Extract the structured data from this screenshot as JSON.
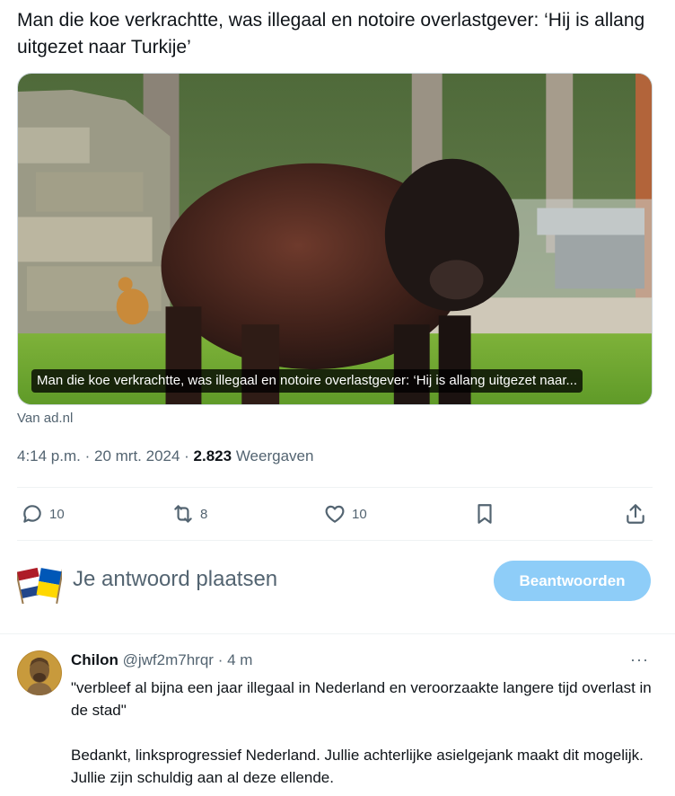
{
  "tweet": {
    "text": "Man die koe verkrachtte, was illegaal en notoire overlastgever: ‘Hij is allang uitgezet naar Turkije’"
  },
  "card": {
    "caption": "Man die koe verkrachtte, was illegaal en notoire overlastgever: ‘Hij is allang uitgezet naar...",
    "source": "Van ad.nl"
  },
  "meta": {
    "time": "4:14 p.m.",
    "sep1": " · ",
    "date": "20 mrt. 2024",
    "sep2": " · ",
    "views": "2.823",
    "views_label": " Weergaven"
  },
  "actions": {
    "replies": "10",
    "reposts": "8",
    "likes": "10"
  },
  "reply_box": {
    "placeholder": "Je antwoord plaatsen",
    "button": "Beantwoorden"
  },
  "reply": {
    "name": "Chilon",
    "handle": "@jwf2m7hrqr",
    "time": " · 4 m",
    "more": "···",
    "paragraph1": "\"verbleef al bijna een jaar illegaal in Nederland en veroorzaakte langere tijd overlast in de stad\"",
    "paragraph2": "Bedankt, linksprogressief Nederland. Jullie achterlijke asielgejank maakt dit mogelijk. Jullie zijn schuldig aan al deze ellende."
  },
  "colors": {
    "text": "#0f1419",
    "secondary": "#536471",
    "button_disabled": "#8ecdf8",
    "border": "#cfd9de"
  }
}
